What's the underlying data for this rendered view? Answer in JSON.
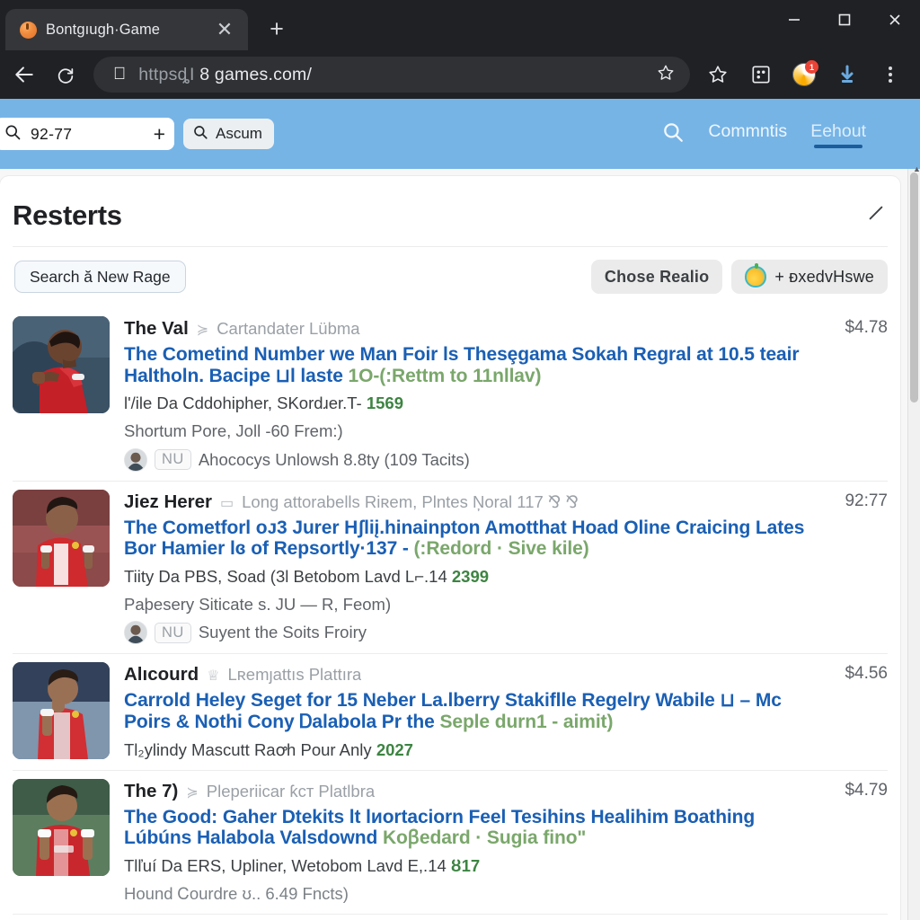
{
  "browser": {
    "tab": {
      "title": "Bontgıugh·Game",
      "close_label": "✕"
    },
    "new_tab_label": "+",
    "window": {
      "minimize": "–",
      "maximize": "▢",
      "close": "✕"
    },
    "omnibox": {
      "url_prefix": "httpsȡI",
      "url_main": " 8 games.com/",
      "apple_glyph": ""
    }
  },
  "appbar": {
    "search": {
      "value": "92-77",
      "placeholder": "92-77",
      "add_label": "+"
    },
    "ascum_button": "Ascum",
    "links": [
      {
        "label": "Commntis",
        "active": false
      },
      {
        "label": "Eehout",
        "active": true
      }
    ]
  },
  "card": {
    "title": "Resterts",
    "new_rage_button": "Search ă New Rage",
    "chose_realio_button": "Chose  Realio",
    "add_button": "+ ᴆxedvHswe"
  },
  "results": [
    {
      "name": "The Val",
      "meta": "Cartandater Lübma",
      "meta_icon": "≽",
      "title_main": "The Cometind Number we Man Foir ls Thesȩgama Sokah Regral at 10.5 teair Haltholn. Bacipe ⊔l laste ",
      "title_green": "1O-(:Rettm to 11nllaᴠ)",
      "sub1": "l'/ile Da Cddohipher, SKordɹer.T-",
      "sub1_green": "1569",
      "sub2": "Shortum Pore, Joll -60 Frem:)",
      "byline_badge": "NU",
      "byline_text": "Ahococys Unlowsh 8.8ty (109 Tacits)",
      "price": "$4.78"
    },
    {
      "name": "Jiez Herer",
      "meta": "Long attorabells Riʀem, Plntes Ņoral 117 ⅋ ⅋",
      "meta_icon": "▭",
      "title_main": "The Cometforl oᴊ3 Jurer Hʃliį.hinainpton Amotthat Hoad Oline Craicing Lates Bor Hamier lɞ of Repsortly·137 - ",
      "title_green": "(:Redord · Sive kile)",
      "sub1": "Tiity Da PBS, Soad (3l Betobom Lavd L⌐.14",
      "sub1_green": "2399",
      "sub2": "Paþesery Siticate s. JU — R, Feom)",
      "byline_badge": "NU",
      "byline_text": "Suyent the Soits Froiry",
      "price": "92:77"
    },
    {
      "name": "Alıcourd",
      "meta": "Lʀemȷattıs Plattıra",
      "meta_icon": "♕",
      "title_main": "Carrold Heley Seget for 15 Neber La.lberry Stakiflle Regelry Wabile ⊔ – Mc Poirs & Nothi Cony Ꭰalabola Pr the ",
      "title_green": "Seple durn1 - aimit)",
      "sub1": "Tl₂ylindy Mascutt Raꝍh Pour Anly",
      "sub1_green": "2027",
      "sub2": "",
      "byline_badge": "",
      "byline_text": "",
      "price": "$4.56"
    },
    {
      "name": "The 7)",
      "meta": "Pleperiicar ƙᴄᴛ Platlbra",
      "meta_icon": "≽",
      "title_main": "The Good: Gaher Dtekits lt lᴎortaciorn Feel Tesihins Healihim Boathing Lúbúns Halabola  Valsdownd ",
      "title_green": "Koꞵedard · Sugia fino\"",
      "sub1": "Tlľuí Da ERS, Upliner, Wetobom Lavd E,.14",
      "sub1_green": "ȣ17",
      "sub2": "Hound Ꮯourdre ʊ.. 6.49 Fncts)",
      "byline_badge": "",
      "byline_text": "",
      "price": "$4.79"
    }
  ]
}
